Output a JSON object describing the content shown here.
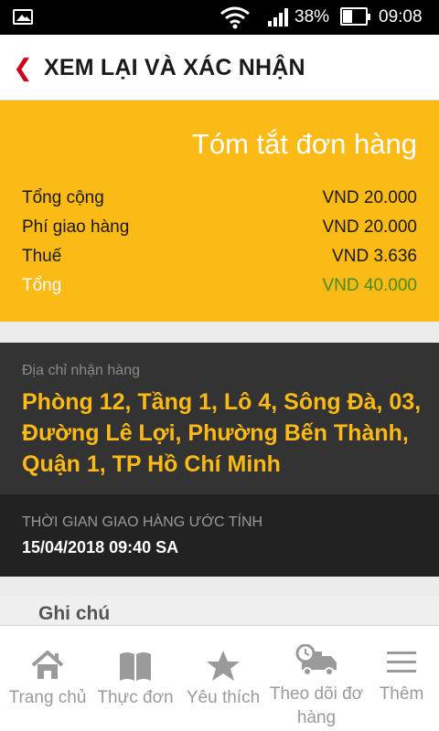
{
  "status_bar": {
    "battery_percent": "38%",
    "time": "09:08"
  },
  "header": {
    "title": "XEM LẠI VÀ XÁC NHẬN"
  },
  "summary": {
    "heading": "Tóm tắt đơn hàng",
    "rows": [
      {
        "label": "Tổng cộng",
        "value": "VND 20.000"
      },
      {
        "label": "Phí giao hàng",
        "value": "VND 20.000"
      },
      {
        "label": "Thuế",
        "value": "VND 3.636"
      },
      {
        "label": "Tổng",
        "value": "VND 40.000"
      }
    ],
    "total_color": "#4e8a1e",
    "background_color": "#fbba15"
  },
  "address": {
    "label": "Địa chỉ nhận hàng",
    "value": "Phòng 12, Tầng 1, Lô 4, Sông Đà, 03, Đường Lê Lợi, Phường Bến Thành, Quận 1, TP Hồ Chí Minh"
  },
  "delivery": {
    "label": "THỜI GIAN GIAO HÀNG ƯỚC TÍNH",
    "value": "15/04/2018 09:40 SA"
  },
  "notes": {
    "label": "Ghi chú"
  },
  "bottom_nav": {
    "items": [
      {
        "label": "Trang chủ",
        "icon": "home-icon"
      },
      {
        "label": "Thực đơn",
        "icon": "menu-book-icon"
      },
      {
        "label": "Yêu thích",
        "icon": "star-icon"
      },
      {
        "label": "Theo dõi đơ hàng",
        "icon": "delivery-truck-icon"
      },
      {
        "label": "Thêm",
        "icon": "hamburger-icon"
      }
    ]
  }
}
